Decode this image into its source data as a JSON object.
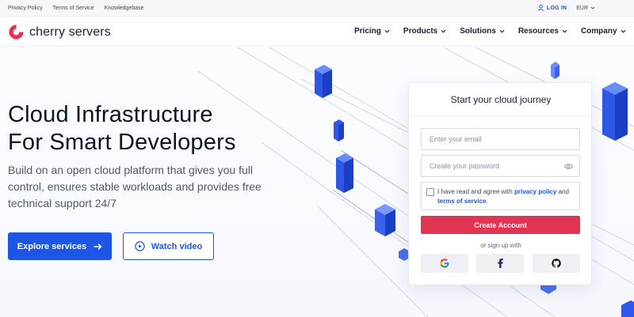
{
  "topbar": {
    "links": [
      "Privacy Policy",
      "Terms of Service",
      "Knowledgebase"
    ],
    "login_label": "LOG IN",
    "currency": "EUR"
  },
  "nav": {
    "brand": "cherry servers",
    "menu": [
      "Pricing",
      "Products",
      "Solutions",
      "Resources",
      "Company"
    ]
  },
  "hero": {
    "title_line1": "Cloud Infrastructure",
    "title_line2": "For Smart Developers",
    "subtitle": "Build on an open cloud platform that gives you full control, ensures stable workloads and provides free technical support 24/7",
    "primary_cta": "Explore services",
    "secondary_cta": "Watch video"
  },
  "signup": {
    "title": "Start your cloud journey",
    "email_placeholder": "Enter your email",
    "password_placeholder": "Create your password",
    "agree_prefix": "I have read and agree with",
    "privacy_link": "privacy policy",
    "and": "and",
    "terms_link": "terms of service",
    "agree_suffix": ".",
    "create_button": "Create Account",
    "or_text": "or sign up with"
  },
  "colors": {
    "accent_blue": "#1d56e6",
    "cta_red": "#e23553",
    "brand_red": "#e23553"
  }
}
